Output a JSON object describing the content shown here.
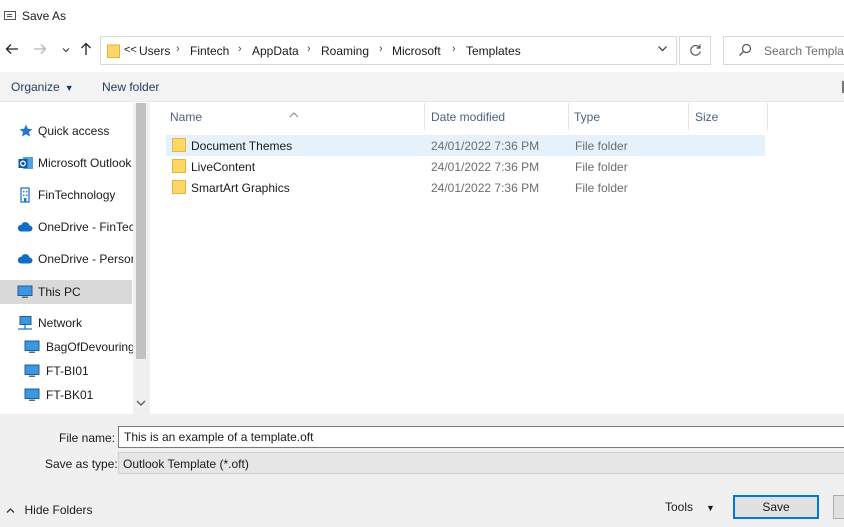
{
  "window": {
    "title": "Save As"
  },
  "nav": {
    "back_icon": "arrow-left-icon",
    "forward_icon": "arrow-right-icon",
    "recent_icon": "chevron-down-icon",
    "up_icon": "arrow-up-icon"
  },
  "address": {
    "overflow": "<<",
    "crumbs": [
      "Users",
      "Fintech",
      "AppData",
      "Roaming",
      "Microsoft",
      "Templates"
    ]
  },
  "search": {
    "placeholder": "Search Templates"
  },
  "commands": {
    "organize": "Organize",
    "new_folder": "New folder"
  },
  "sidebar": {
    "items": [
      {
        "label": "Quick access",
        "icon": "star-icon"
      },
      {
        "label": "Microsoft Outlook",
        "icon": "outlook-icon"
      },
      {
        "label": "FinTechnology",
        "icon": "building-icon"
      },
      {
        "label": "OneDrive - FinTechnology",
        "icon": "cloud-icon"
      },
      {
        "label": "OneDrive - Personal",
        "icon": "cloud-icon"
      },
      {
        "label": "This PC",
        "icon": "computer-icon",
        "selected": true
      },
      {
        "label": "Network",
        "icon": "network-icon"
      },
      {
        "label": "BagOfDevouring",
        "icon": "computer-icon"
      },
      {
        "label": "FT-BI01",
        "icon": "computer-icon"
      },
      {
        "label": "FT-BK01",
        "icon": "computer-icon"
      }
    ]
  },
  "file_list": {
    "columns": [
      "Name",
      "Date modified",
      "Type",
      "Size"
    ],
    "rows": [
      {
        "name": "Document Themes",
        "date": "24/01/2022 7:36 PM",
        "type": "File folder",
        "size": ""
      },
      {
        "name": "LiveContent",
        "date": "24/01/2022 7:36 PM",
        "type": "File folder",
        "size": ""
      },
      {
        "name": "SmartArt Graphics",
        "date": "24/01/2022 7:36 PM",
        "type": "File folder",
        "size": ""
      }
    ]
  },
  "form": {
    "file_name_label": "File name:",
    "file_name_value": "This is an example of a template.oft",
    "save_type_label": "Save as type:",
    "save_type_value": "Outlook Template (*.oft)"
  },
  "footer": {
    "hide_folders": "Hide Folders",
    "tools": "Tools",
    "save": "Save"
  },
  "colors": {
    "accent": "#0078d7",
    "selected_row": "#e5f1fb",
    "folder": "#ffd767"
  }
}
